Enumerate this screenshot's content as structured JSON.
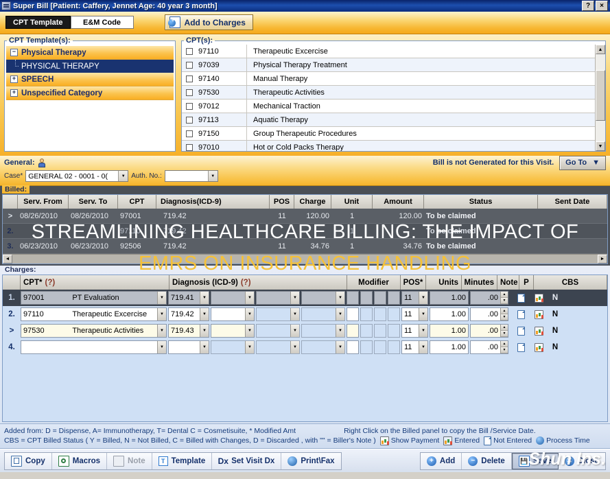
{
  "window": {
    "title": "Super Bill  [Patient: Caffery, Jennet   Age: 40 year 3 month]",
    "help_button": "?",
    "close_button": "×"
  },
  "tabs": {
    "cpt_template": "CPT Template",
    "em_code": "E&M Code",
    "add_to_charges": "Add to Charges"
  },
  "template_panel": {
    "legend": "CPT Template(s):",
    "nodes": [
      {
        "label": "Physical Therapy",
        "expander": "−",
        "expanded": true,
        "children": [
          {
            "label": "PHYSICAL THERAPY",
            "selected": true
          }
        ]
      },
      {
        "label": "SPEECH",
        "expander": "+",
        "expanded": false,
        "children": []
      },
      {
        "label": "Unspecified Category",
        "expander": "+",
        "expanded": false,
        "children": []
      }
    ]
  },
  "cpt_panel": {
    "legend": "CPT(s):",
    "rows": [
      {
        "code": "97110",
        "description": "Therapeutic Excercise",
        "checked": false
      },
      {
        "code": "97039",
        "description": "Physical Therapy Treatment",
        "checked": false
      },
      {
        "code": "97140",
        "description": "Manual Therapy",
        "checked": false
      },
      {
        "code": "97530",
        "description": "Therapeutic Activities",
        "checked": false
      },
      {
        "code": "97012",
        "description": "Mechanical Traction",
        "checked": false
      },
      {
        "code": "97113",
        "description": "Aquatic Therapy",
        "checked": false
      },
      {
        "code": "97150",
        "description": "Group Therapeutic Procedures",
        "checked": false
      },
      {
        "code": "97010",
        "description": "Hot or Cold Packs Therapy",
        "checked": false
      }
    ],
    "scroll_up": "▲",
    "scroll_down": "▼"
  },
  "general": {
    "label": "General:",
    "case_label": "Case*",
    "case_value": "GENERAL 02  -  0001 - 0(",
    "auth_label": "Auth. No.:",
    "auth_value": "",
    "bill_status": "Bill is not Generated for this Visit.",
    "goto_label": "Go To",
    "goto_arrow": "▼"
  },
  "billed": {
    "legend": "Billed:",
    "columns": [
      "",
      "Serv. From",
      "Serv. To",
      "CPT",
      "Diagnosis(ICD-9)",
      "POS",
      "Charge",
      "Unit",
      "Amount",
      "Status",
      "Sent Date"
    ],
    "rows": [
      {
        "marker": ">",
        "serv_from": "08/26/2010",
        "serv_to": "08/26/2010",
        "cpt": "97001",
        "diagnosis": "719.42",
        "pos": "11",
        "charge": "120.00",
        "unit": "1",
        "amount": "120.00",
        "status": "To be claimed",
        "sent_date": ""
      },
      {
        "marker": "2.",
        "serv_from": "",
        "serv_to": "",
        "cpt": "97110",
        "diagnosis": "719.42",
        "pos": "",
        "charge": "",
        "unit": "1",
        "amount": "",
        "status": "To be claimed",
        "sent_date": ""
      },
      {
        "marker": "3.",
        "serv_from": "06/23/2010",
        "serv_to": "06/23/2010",
        "cpt": "92506",
        "diagnosis": "719.42",
        "pos": "11",
        "charge": "34.76",
        "unit": "1",
        "amount": "34.76",
        "status": "To be claimed",
        "sent_date": ""
      }
    ],
    "scroll_left": "◄",
    "scroll_right": "►"
  },
  "charges": {
    "legend": "Charges:",
    "columns": {
      "cpt": "CPT*",
      "cpt_help": "(?)",
      "diagnosis": "Diagnosis (ICD-9)",
      "diagnosis_help": "(?)",
      "modifier": "Modifier",
      "pos": "POS*",
      "units": "Units",
      "minutes": "Minutes",
      "note": "Note",
      "p": "P",
      "cbs": "CBS"
    },
    "rows": [
      {
        "num": "1.",
        "selected": true,
        "cpt_code": "97001",
        "cpt_desc": "PT Evaluation",
        "dx1": "719.41",
        "dx2": "",
        "dx3": "",
        "dx4": "",
        "mod1": "",
        "mod2": "",
        "mod3": "",
        "mod4": "",
        "pos": "11",
        "units": "1.00",
        "minutes": ".00",
        "cbs": "N"
      },
      {
        "num": "2.",
        "selected": false,
        "cpt_code": "97110",
        "cpt_desc": "Therapeutic Excercise",
        "dx1": "719.42",
        "dx2": "",
        "dx3": "",
        "dx4": "",
        "mod1": "",
        "mod2": "",
        "mod3": "",
        "mod4": "",
        "pos": "11",
        "units": "1.00",
        "minutes": ".00",
        "cbs": "N"
      },
      {
        "num": ">",
        "selected": false,
        "cpt_code": "97530",
        "cpt_desc": "Therapeutic Activities",
        "dx1": "719.43",
        "dx2": "",
        "dx3": "",
        "dx4": "",
        "mod1": "",
        "mod2": "",
        "mod3": "",
        "mod4": "",
        "pos": "11",
        "units": "1.00",
        "minutes": ".00",
        "cbs": "N"
      },
      {
        "num": "4.",
        "selected": false,
        "cpt_code": "",
        "cpt_desc": "",
        "dx1": "",
        "dx2": "",
        "dx3": "",
        "dx4": "",
        "mod1": "",
        "mod2": "",
        "mod3": "",
        "mod4": "",
        "pos": "11",
        "units": "1.00",
        "minutes": ".00",
        "cbs": "N"
      }
    ]
  },
  "footer_legend": {
    "line1_left": "Added from: D = Dispense, A= Immunotherapy, T= Dental  C = Cosmetisuite,   * Modified Amt",
    "line1_right": "Right Click on the Billed panel to copy the Bill /Service Date.",
    "line2": "CBS = CPT Billed Status ( Y = Billed, N = Not Billed, C = Billed with Changes, D = Discarded , with \"\" = Biller's Note )",
    "show_payment": "Show Payment",
    "entered": "Entered",
    "not_entered": "Not Entered",
    "process_time": "Process Time"
  },
  "toolbar": {
    "copy": "Copy",
    "macros": "Macros",
    "note": "Note",
    "template": "Template",
    "set_visit_dx": "Set Visit Dx",
    "print_fax": "Print\\Fax",
    "add": "Add",
    "delete": "Delete",
    "save": "Save",
    "close": "Close",
    "add_symbol": "+",
    "delete_symbol": "−",
    "dx_symbol": "Dx",
    "template_symbol": "T"
  },
  "overlay": {
    "line1": "STREAMLINING HEALTHCARE BILLING: THE IMPACT OF",
    "line2": "EMRS ON INSURANCE HANDLING",
    "watermark": "Shun Ins."
  },
  "colors": {
    "title_blue": "#0a246a",
    "gold": "#f7b731",
    "accent_navy": "#14306b",
    "selection": "#193370",
    "overlay_white": "#ffffff",
    "overlay_gold": "#f5c138"
  }
}
